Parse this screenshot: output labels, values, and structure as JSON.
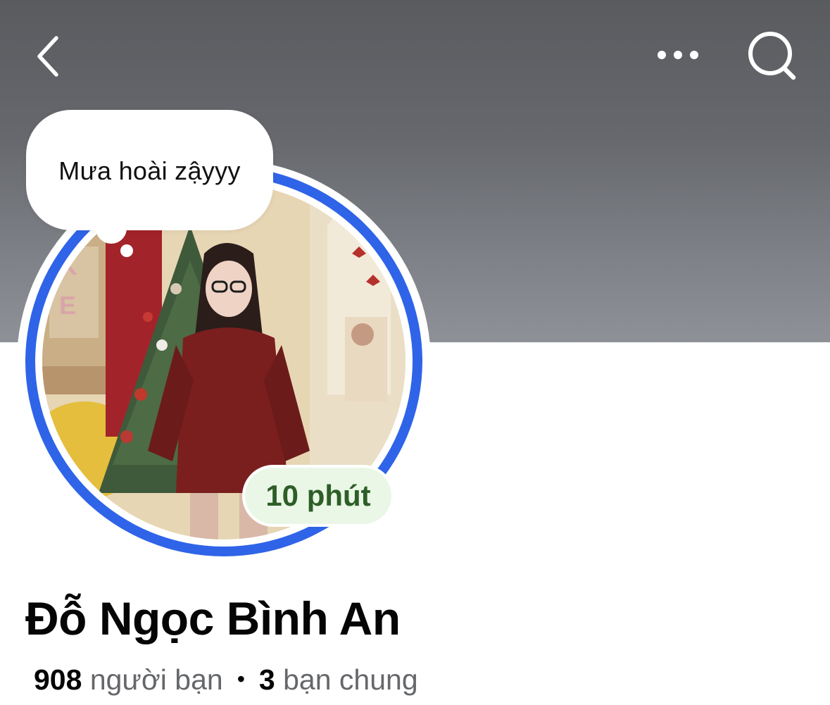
{
  "header": {
    "back_icon": "chevron-left-icon",
    "more_icon": "more-horizontal-icon",
    "search_icon": "search-icon",
    "cover_color": "#6a6c71"
  },
  "note": {
    "text": "Mưa hoài zậyyy"
  },
  "avatar": {
    "ring_color": "#2f64e8",
    "status_label": "10 phút",
    "status_color": "#2e5e27"
  },
  "profile": {
    "name": "Đỗ Ngọc Bình An",
    "friends_count": "908",
    "friends_label": "người bạn",
    "separator": "•",
    "mutual_count": "3",
    "mutual_label": "bạn chung"
  }
}
